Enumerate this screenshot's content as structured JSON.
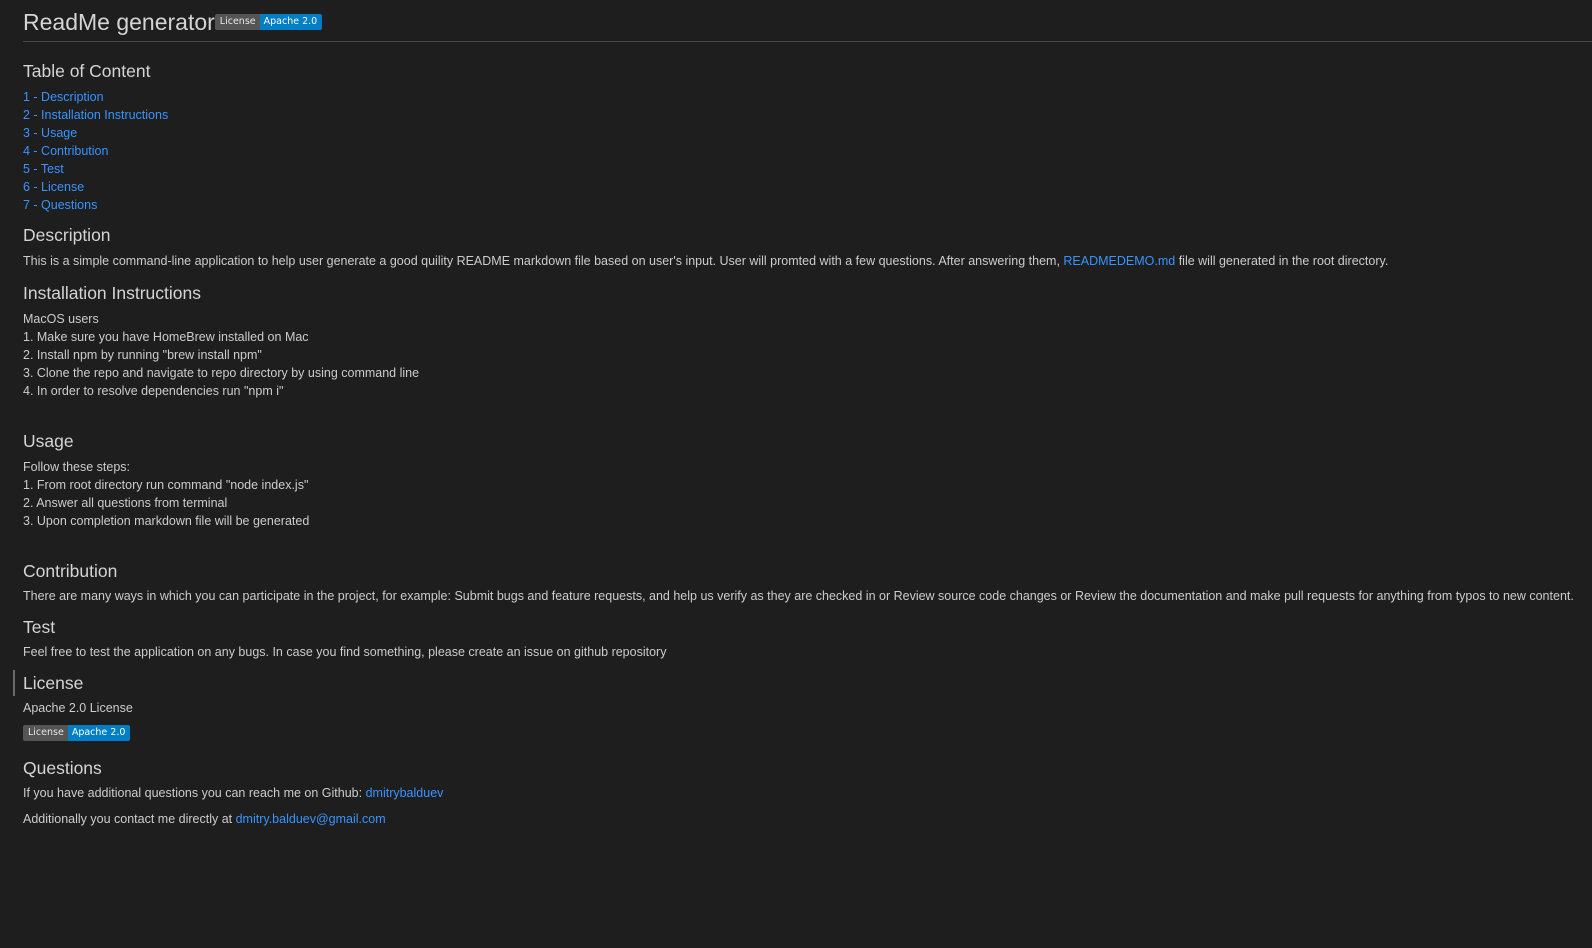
{
  "header": {
    "title": "ReadMe generator",
    "badge": {
      "label": "License",
      "value": "Apache 2.0",
      "label_color": "#555555",
      "value_color": "#007ec6"
    }
  },
  "toc": {
    "title": "Table of Content",
    "items": [
      {
        "label": "1 - Description"
      },
      {
        "label": "2 - Installation Instructions"
      },
      {
        "label": "3 - Usage"
      },
      {
        "label": "4 - Contribution"
      },
      {
        "label": "5 - Test"
      },
      {
        "label": "6 - License"
      },
      {
        "label": "7 - Questions"
      }
    ]
  },
  "description": {
    "title": "Description",
    "text_before": "This is a simple command-line application to help user generate a good quility README markdown file based on user's input. User will promted with a few questions. After answering them, ",
    "link": "READMEDEMO.md",
    "text_after": " file will generated in the root directory."
  },
  "installation": {
    "title": "Installation Instructions",
    "lines": [
      "MacOS users",
      "1. Make sure you have HomeBrew installed on Mac",
      "2. Install npm by running \"brew install npm\"",
      "3. Clone the repo and navigate to repo directory by using command line",
      "4. In order to resolve dependencies run \"npm i\""
    ]
  },
  "usage": {
    "title": "Usage",
    "lines": [
      "Follow these steps:",
      "1. From root directory run command \"node index.js\"",
      "2. Answer all questions from terminal",
      "3. Upon completion markdown file will be generated"
    ]
  },
  "contribution": {
    "title": "Contribution",
    "text": "There are many ways in which you can participate in the project, for example: Submit bugs and feature requests, and help us verify as they are checked in or Review source code changes or Review the documentation and make pull requests for anything from typos to new content."
  },
  "test": {
    "title": "Test",
    "text": "Feel free to test the application on any bugs. In case you find something, please create an issue on github repository"
  },
  "license": {
    "title": "License",
    "text": "Apache 2.0 License",
    "badge": {
      "label": "License",
      "value": "Apache 2.0"
    }
  },
  "questions": {
    "title": "Questions",
    "github_text": "If you have additional questions you can reach me on Github: ",
    "github_link": "dmitrybalduev",
    "email_text": "Additionally you contact me directly at ",
    "email_link": "dmitry.balduev@gmail.com"
  }
}
